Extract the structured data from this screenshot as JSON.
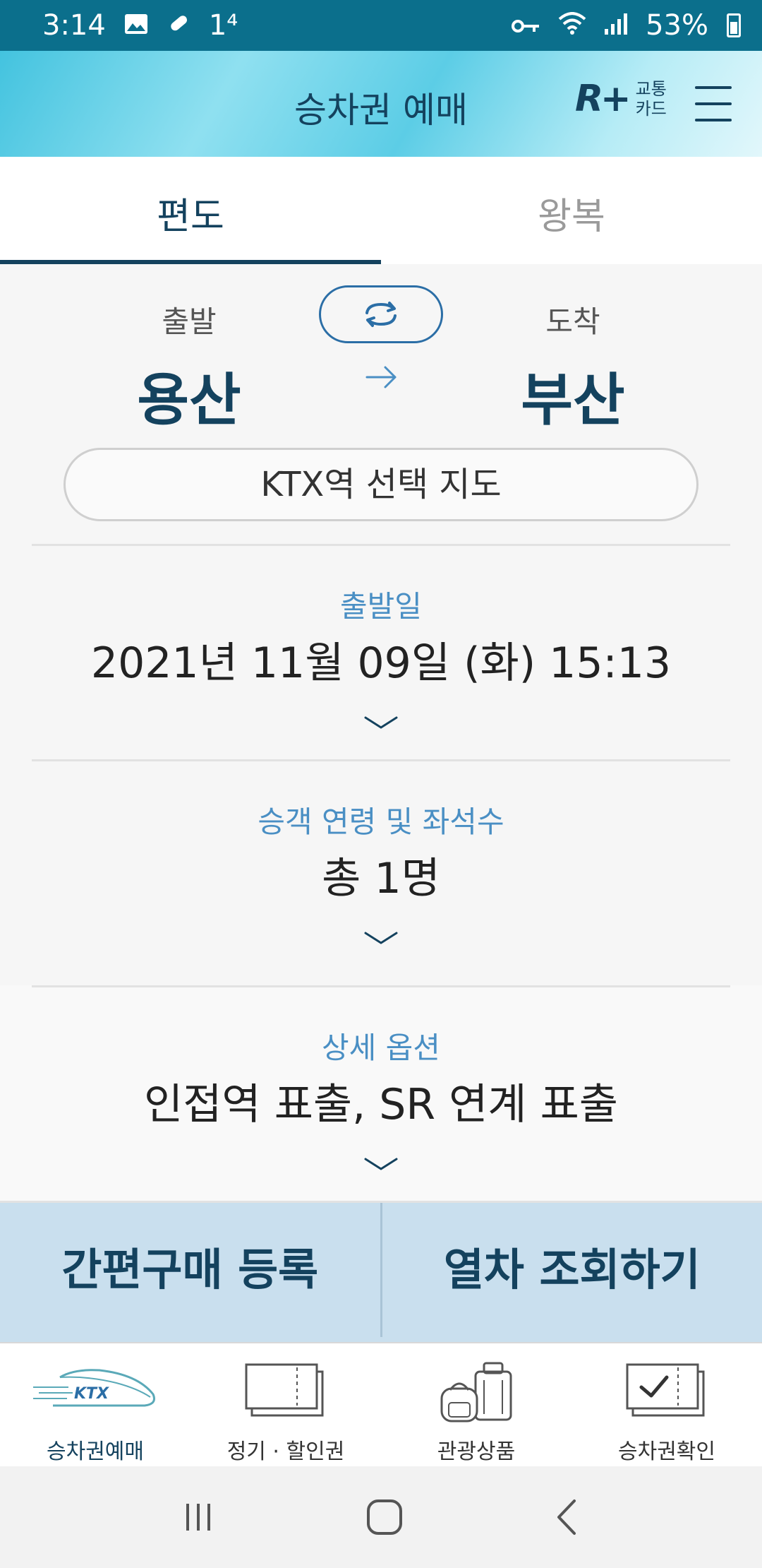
{
  "status_bar": {
    "time": "3:14",
    "notification": "1⁴",
    "battery": "53%"
  },
  "app_bar": {
    "title": "승차권 예매",
    "card_logo_mark": "R+",
    "card_logo_text_1": "교통",
    "card_logo_text_2": "카드"
  },
  "tabs": [
    {
      "label": "편도",
      "active": true
    },
    {
      "label": "왕복",
      "active": false
    }
  ],
  "route": {
    "departure_label": "출발",
    "departure_station": "용산",
    "arrival_label": "도착",
    "arrival_station": "부산",
    "map_button": "KTX역 선택 지도"
  },
  "sections": {
    "date": {
      "label": "출발일",
      "value": "2021년 11월 09일 (화) 15:13"
    },
    "passengers": {
      "label": "승객 연령 및 좌석수",
      "value": "총 1명"
    },
    "options": {
      "label": "상세 옵션",
      "value": "인접역 표출, SR 연계 표출"
    }
  },
  "actions": {
    "quick_purchase": "간편구매 등록",
    "search_trains": "열차 조회하기"
  },
  "bottom_nav": [
    {
      "label": "승차권예매",
      "icon": "ktx-train-icon",
      "active": true
    },
    {
      "label": "정기 · 할인권",
      "icon": "ticket-icon",
      "active": false
    },
    {
      "label": "관광상품",
      "icon": "luggage-icon",
      "active": false
    },
    {
      "label": "승차권확인",
      "icon": "ticket-check-icon",
      "active": false
    }
  ],
  "colors": {
    "primary": "#14425e",
    "accent": "#4a8fc4",
    "status_bar": "#0b6f8c",
    "action_bar": "#c9dfee"
  }
}
